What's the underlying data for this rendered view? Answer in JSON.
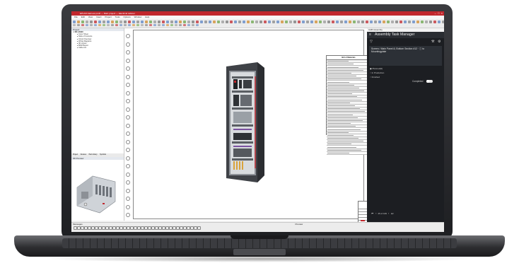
{
  "app": {
    "title": "EPLAN Harness proD — Main project — Electrical cabinet",
    "window_controls": [
      "–",
      "□",
      "×"
    ],
    "menu": [
      "File",
      "Edit",
      "View",
      "Insert",
      "Project",
      "Tools",
      "Options",
      "Window",
      "Help"
    ],
    "brand_color": "#c1272d"
  },
  "tree_panel": {
    "title": "Project",
    "items": [
      "MC-20900",
      "Cover Sheet",
      "Table of Contents",
      "Circuit Overview",
      "Wiring Diagrams",
      "3D Layout",
      "BOM Report",
      "Cable List"
    ]
  },
  "bottom_tabs": [
    "Project",
    "Devices",
    "Part Library",
    "Symbols"
  ],
  "preview_panel": {
    "title": "3D Preview"
  },
  "messages_panel": {
    "title": "Messages",
    "tab": "Preview"
  },
  "drawing": {
    "bom_title": "Bill of Materials",
    "title_block": {
      "line1": "MC20 · SECTION",
      "line2": "ASSY DRAWING",
      "line3": "REV · ISSUE · 01"
    }
  },
  "assembly_panel": {
    "header": "CAB Assembly",
    "title": "Assembly Task Manager",
    "task_text": "Screen / Main Panel-6, Bottom Section #12 · ⓘ to Mountingplate",
    "options": [
      "Planned(0)",
      "In Production",
      "Finished"
    ],
    "completed_label": "Completed",
    "pager": "25 of 109"
  },
  "colors": {
    "panel_dark": "#1c1e22",
    "accent": "#c1272d",
    "cabinet": "#4a4d52"
  }
}
